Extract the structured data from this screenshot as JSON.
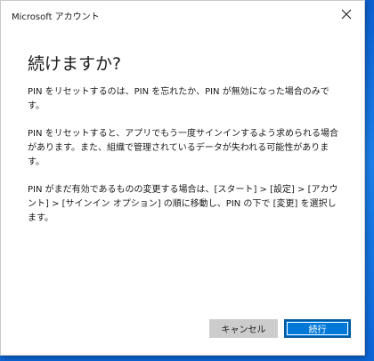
{
  "window": {
    "title": "Microsoft アカウント",
    "close_icon": "close-icon"
  },
  "dialog": {
    "heading": "続けますか?",
    "paragraphs": [
      "PIN をリセットするのは、PIN を忘れたか、PIN が無効になった場合のみです。",
      "PIN をリセットすると、アプリでもう一度サインインするよう求められる場合があります。また、組織で管理されているデータが失われる可能性があります。",
      "PIN がまだ有効であるものの変更する場合は、[スタート] > [設定] > [アカウント] > [サインイン オプション] の順に移動し、PIN の下で [変更] を選択します。"
    ]
  },
  "buttons": {
    "cancel_label": "キャンセル",
    "continue_label": "続行"
  },
  "colors": {
    "accent": "#0078d7",
    "cancel_bg": "#cccccc",
    "desktop": "#1b7fe8"
  }
}
